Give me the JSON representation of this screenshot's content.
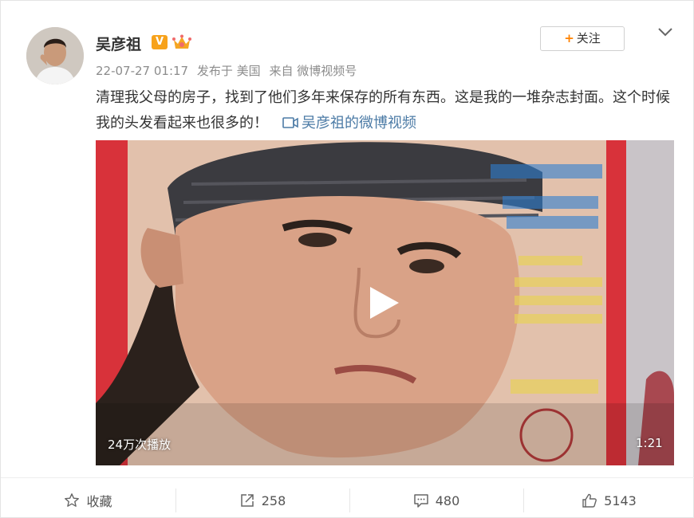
{
  "post": {
    "username": "吴彦祖",
    "verified_badge": "V",
    "meta": {
      "time": "22-07-27 01:17",
      "location": "发布于 美国",
      "source": "来自 微博视频号"
    },
    "follow_label": "关注",
    "text": "清理我父母的房子，找到了他们多年来保存的所有东西。这是我的一堆杂志封面。这个时候我的头发看起来也很多的！",
    "video_link_text": "吴彦祖的微博视频"
  },
  "video": {
    "views": "24万次播放",
    "duration": "1:21"
  },
  "actions": {
    "favorite_label": "收藏",
    "repost_count": "258",
    "comment_count": "480",
    "like_count": "5143"
  },
  "colors": {
    "accent": "#ff8200",
    "link": "#4c7ba6",
    "badge": "#f7a21b"
  },
  "icons": [
    "star-icon",
    "share-icon",
    "comment-icon",
    "thumb-up-icon",
    "chevron-down-icon",
    "play-icon",
    "video-icon",
    "crown-icon"
  ]
}
